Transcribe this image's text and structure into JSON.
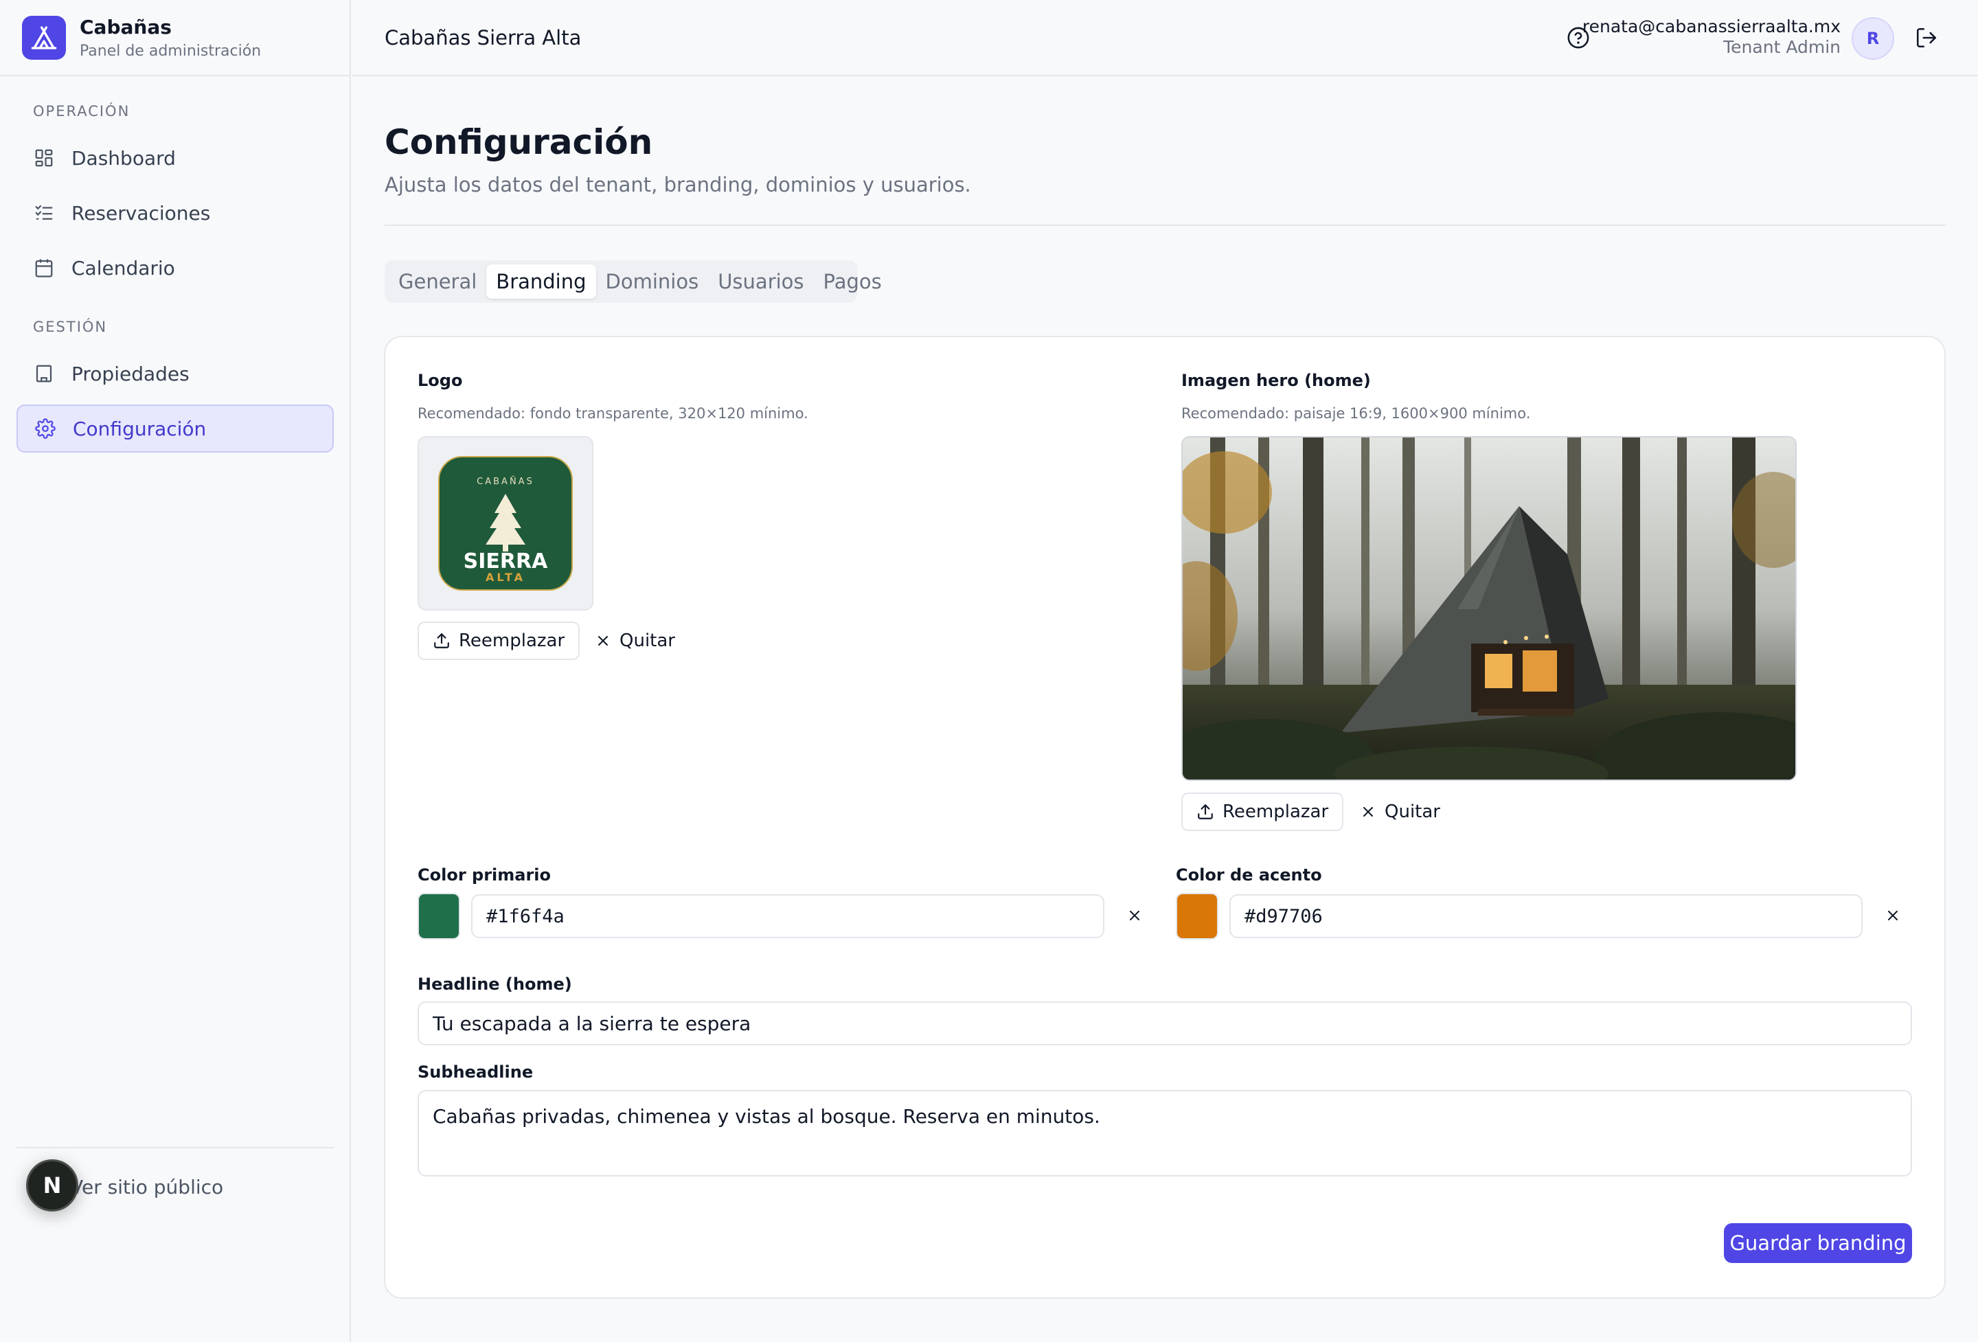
{
  "brand": {
    "title": "Cabañas",
    "subtitle": "Panel de administración"
  },
  "sidebar": {
    "section_operation": "OPERACIÓN",
    "section_management": "GESTIÓN",
    "items": [
      {
        "label": "Dashboard",
        "icon": "dashboard-icon"
      },
      {
        "label": "Reservaciones",
        "icon": "checklist-icon"
      },
      {
        "label": "Calendario",
        "icon": "calendar-icon"
      },
      {
        "label": "Propiedades",
        "icon": "building-icon"
      },
      {
        "label": "Configuración",
        "icon": "gear-icon",
        "active": true
      }
    ],
    "public_link": "Ver sitio público",
    "n_badge": "N"
  },
  "header": {
    "title": "Cabañas Sierra Alta",
    "email": "renata@cabanassierraalta.mx",
    "role": "Tenant Admin",
    "avatar": "R"
  },
  "page": {
    "title": "Configuración",
    "subtitle": "Ajusta los datos del tenant, branding, dominios y usuarios."
  },
  "tabs": [
    {
      "label": "General"
    },
    {
      "label": "Branding",
      "active": true
    },
    {
      "label": "Dominios"
    },
    {
      "label": "Usuarios"
    },
    {
      "label": "Pagos"
    }
  ],
  "branding": {
    "logo_label": "Logo",
    "logo_hint": "Recomendado: fondo transparente, 320×120 mínimo.",
    "logo_text": {
      "top": "CABAÑAS",
      "main": "SIERRA",
      "bottom": "ALTA"
    },
    "hero_label": "Imagen hero (home)",
    "hero_hint": "Recomendado: paisaje 16:9, 1600×900 mínimo.",
    "replace_label": "Reemplazar",
    "remove_label": "Quitar",
    "primary_label": "Color primario",
    "primary_value": "#1f6f4a",
    "accent_label": "Color de acento",
    "accent_value": "#d97706",
    "headline_label": "Headline (home)",
    "headline_value": "Tu escapada a la sierra te espera",
    "subheadline_label": "Subheadline",
    "subheadline_value": "Cabañas privadas, chimenea y vistas al bosque. Reserva en minutos.",
    "save_label": "Guardar branding"
  },
  "colors": {
    "accent": "#4f46e5",
    "primary_swatch": "#1f6f4a",
    "accent_swatch": "#d97706"
  }
}
